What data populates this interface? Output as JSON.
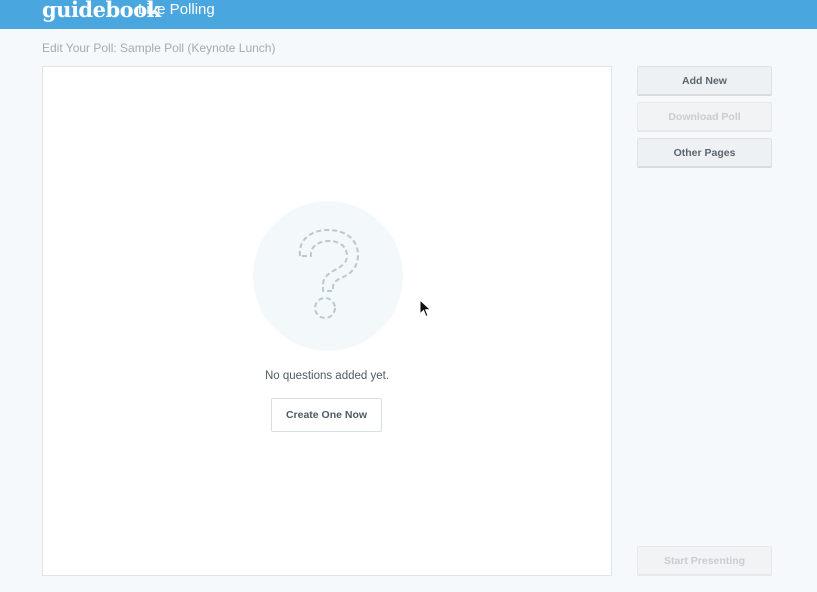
{
  "header": {
    "brand": "guidebook",
    "product": "Live Polling",
    "bar_color": "#4aa6de"
  },
  "page": {
    "title": "Edit Your Poll: Sample Poll (Keynote Lunch)"
  },
  "empty_state": {
    "icon": "question-mark-icon",
    "message": "No questions added yet.",
    "create_label": "Create One Now"
  },
  "sidebar": {
    "add_new": "Add New",
    "download_poll": "Download Poll",
    "other_pages": "Other Pages",
    "start_presenting": "Start Presenting"
  }
}
